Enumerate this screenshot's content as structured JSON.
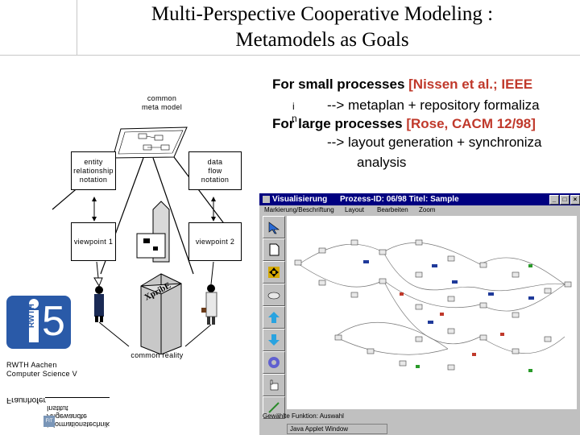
{
  "slide": {
    "title_line1": "Multi-Perspective Cooperative Modeling :",
    "title_line2": "Metamodels as Goals"
  },
  "bullets": {
    "b1_text": "For small processes ",
    "b1_ref": "[Nissen et al.; IEEE",
    "b1_sub": "--> metaplan + repository formaliza",
    "b2_text": "For large processes ",
    "b2_ref": "[Rose, CACM 12/98]",
    "b2_sub": "--> layout generation + synchroniza",
    "b2_sub2": "analysis",
    "marker1": "i",
    "marker2": "n"
  },
  "diagram": {
    "common_metamodel": "common\nmeta model",
    "er_notation": "entity\nrelationship\nnotation",
    "dataflow_notation": "data\nflow\nnotation",
    "viewpoint1": "viewpoint 1",
    "viewpoint2": "viewpoint 2",
    "common_reality": "common reality",
    "building_label": "XpribE"
  },
  "footer": {
    "rwth_number": "5",
    "rwth_text": "RWTH",
    "rwth_line1": "RWTH Aachen",
    "rwth_line2": "Computer Science V",
    "fraunhofer": "Fraunhofer",
    "institut1": "Institut",
    "institut2": "Angewandte",
    "institut3": "Informationstechnik",
    "fit": "FIT"
  },
  "applet": {
    "title": "Visualisierung",
    "process": "Prozess-ID: 06/98 Titel: Sample",
    "menu": [
      "Markierung/Beschriftung",
      "Layout",
      "Bearbeiten",
      "Zoom"
    ],
    "status_label": "Gewählte Funktion: Auswahl",
    "status_window": "Java Applet Window",
    "title_color": "#000080"
  }
}
